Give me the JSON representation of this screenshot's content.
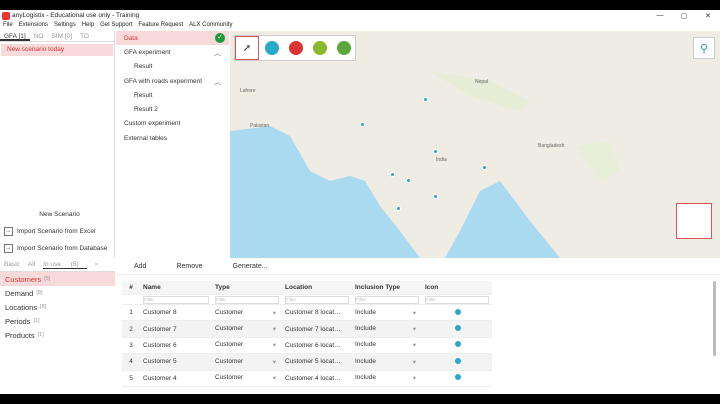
{
  "window": {
    "title": "anyLogistix - Educational use only - Training",
    "min": "—",
    "max": "▢",
    "close": "✕"
  },
  "menu": [
    "File",
    "Extensions",
    "Settings",
    "Help",
    "Get Support",
    "Feature Request",
    "ALX Community"
  ],
  "tabs": [
    {
      "label": "GFA",
      "count": "[1]"
    },
    {
      "label": "NO",
      "count": ""
    },
    {
      "label": "SIM",
      "count": "[0]"
    },
    {
      "label": "TO",
      "count": ""
    }
  ],
  "scenario": "New scenario today",
  "left_actions": {
    "new": "New Scenario",
    "import_excel": "Import Scenario from Excel",
    "import_db": "Import Scenario from Database"
  },
  "tree": {
    "data": "Data",
    "gfa": "GFA experiment",
    "result1": "Result",
    "gfa_roads": "GFA with roads experiment",
    "result2": "Result",
    "result3": "Result 2",
    "custom": "Custom experiment",
    "external": "External tables"
  },
  "map_labels": [
    "Lahore",
    "Nepal",
    "India",
    "Bangladesh",
    "Pakistan"
  ],
  "bottom_toolbar": {
    "add": "Add",
    "remove": "Remove",
    "generate": "Generate..."
  },
  "left_bottom_tabs": {
    "basic": "Basic",
    "all": "All",
    "in_use": "In use",
    "in_use_count": "(5)"
  },
  "tables": [
    {
      "label": "Customers",
      "count": "[5]"
    },
    {
      "label": "Demand",
      "count": "[8]"
    },
    {
      "label": "Locations",
      "count": "[8]"
    },
    {
      "label": "Periods",
      "count": "[1]"
    },
    {
      "label": "Products",
      "count": "[1]"
    }
  ],
  "grid": {
    "headers": [
      "#",
      "Name",
      "Type",
      "Location",
      "Inclusion Type",
      "Icon"
    ],
    "filter_placeholder": "Filter",
    "rows": [
      {
        "n": "1",
        "name": "Customer 8",
        "type": "Customer",
        "loc": "Customer 8 locat…",
        "incl": "Include"
      },
      {
        "n": "2",
        "name": "Customer 7",
        "type": "Customer",
        "loc": "Customer 7 locat…",
        "incl": "Include"
      },
      {
        "n": "3",
        "name": "Customer 6",
        "type": "Customer",
        "loc": "Customer 6 locat…",
        "incl": "Include"
      },
      {
        "n": "4",
        "name": "Customer 5",
        "type": "Customer",
        "loc": "Customer 5 locat…",
        "incl": "Include"
      },
      {
        "n": "5",
        "name": "Customer 4",
        "type": "Customer",
        "loc": "Customer 4 locat…",
        "incl": "Include"
      }
    ]
  },
  "colors": {
    "accent": "#d33333",
    "map_water": "#aadaf0",
    "map_land": "#efece4",
    "pin": "#2aa8c8"
  }
}
